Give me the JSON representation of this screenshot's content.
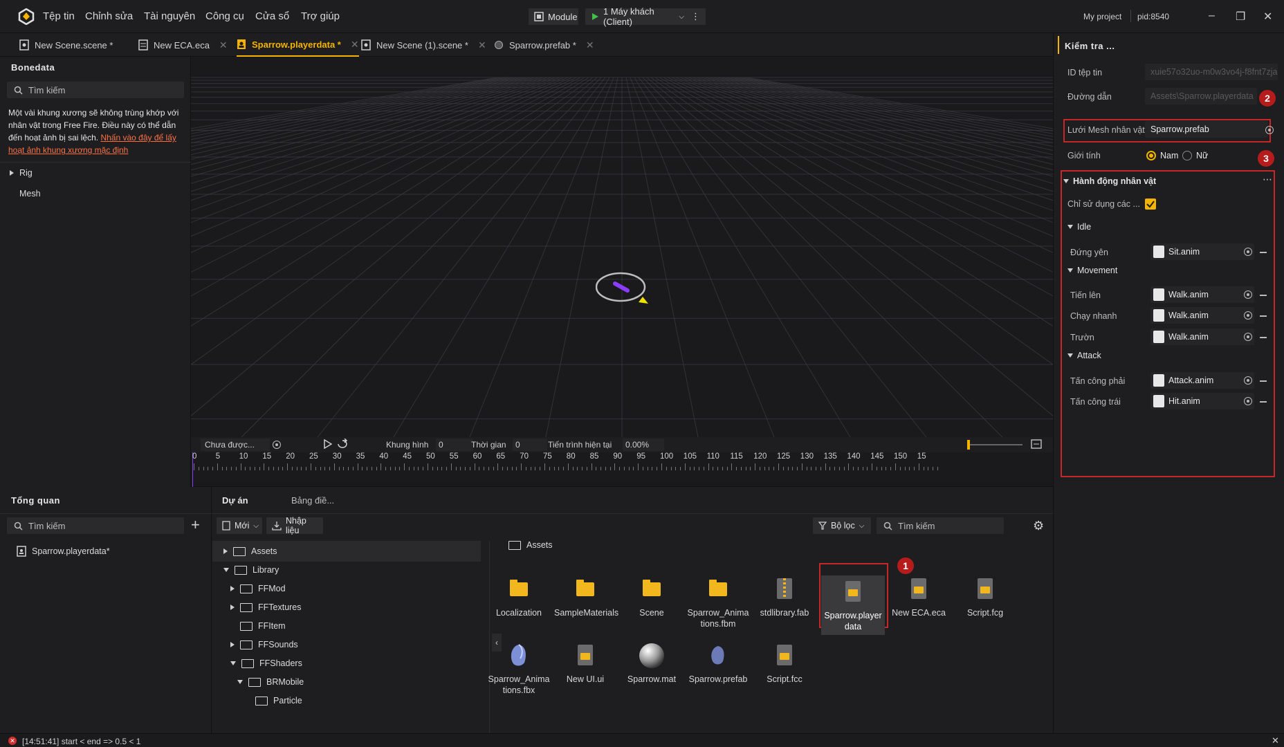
{
  "menu": [
    "Tệp tin",
    "Chỉnh sửa",
    "Tài nguyên",
    "Công cụ",
    "Cửa sổ",
    "Trợ giúp"
  ],
  "toolbar": {
    "module_label": "Module",
    "client_label": "1 Máy khách (Client)"
  },
  "project": {
    "name": "My project",
    "pid": "pid:8540"
  },
  "tabs": [
    {
      "label": "New Scene.scene *"
    },
    {
      "label": "New ECA.eca"
    },
    {
      "label": "Sparrow.playerdata *"
    },
    {
      "label": "New Scene (1).scene *"
    },
    {
      "label": "Sparrow.prefab *"
    }
  ],
  "bonedata": {
    "title": "Bonedata",
    "search_placeholder": "Tìm kiếm",
    "warning": "Một vài khung xương sẽ không trùng khớp với nhân vật trong Free Fire. Điều này có thể dẫn đến hoạt ảnh bị sai lệch.",
    "warning_link": "Nhấn vào đây để lấy hoạt ảnh khung xương mặc định",
    "tree": [
      "Rig",
      "Mesh"
    ]
  },
  "timeline": {
    "clip": "Chưa được...",
    "frame_label": "Khung hình",
    "frame_value": "0",
    "time_label": "Thời gian",
    "time_value": "0",
    "progress_label": "Tiến trình hiện tại",
    "progress_value": "0.00%",
    "ticks": [
      "0",
      "5",
      "10",
      "15",
      "20",
      "25",
      "30",
      "35",
      "40",
      "45",
      "50",
      "55",
      "60",
      "65",
      "70",
      "75",
      "80",
      "85",
      "90",
      "95",
      "100",
      "105",
      "110",
      "115",
      "120",
      "125",
      "130",
      "135",
      "140",
      "145",
      "150",
      "15"
    ]
  },
  "inspector": {
    "title": "Kiểm tra ...",
    "file_id_label": "ID tệp tin",
    "file_id_value": "xuie57o32uo-m0w3vo4j-f8fnt7zja",
    "path_label": "Đường dẫn",
    "path_value": "Assets\\Sparrow.playerdata",
    "mesh_label": "Lưới Mesh nhân vật",
    "mesh_value": "Sparrow.prefab",
    "gender_label": "Giới tính",
    "gender_male": "Nam",
    "gender_female": "Nữ",
    "actions_title": "Hành động nhân vật",
    "only_use_label": "Chỉ sử dụng các ...",
    "groups": [
      {
        "name": "Idle",
        "items": [
          {
            "label": "Đứng yên",
            "value": "Sit.anim"
          }
        ]
      },
      {
        "name": "Movement",
        "items": [
          {
            "label": "Tiến lên",
            "value": "Walk.anim"
          },
          {
            "label": "Chạy nhanh",
            "value": "Walk.anim"
          },
          {
            "label": "Trườn",
            "value": "Walk.anim"
          }
        ]
      },
      {
        "name": "Attack",
        "items": [
          {
            "label": "Tấn công phải",
            "value": "Attack.anim"
          },
          {
            "label": "Tấn công trái",
            "value": "Hit.anim"
          }
        ]
      }
    ],
    "badges": [
      "2",
      "3"
    ]
  },
  "overview": {
    "title": "Tổng quan",
    "search_placeholder": "Tìm kiếm",
    "item": "Sparrow.playerdata*"
  },
  "project_panel": {
    "tab_project": "Dự án",
    "tab_board": "Bảng điề...",
    "new_label": "Mới",
    "import_label": "Nhập liệu",
    "filter_label": "Bộ lọc",
    "search_placeholder": "Tìm kiếm",
    "breadcrumb": "Assets",
    "tree": [
      {
        "label": "Assets"
      },
      {
        "label": "Library"
      },
      {
        "label": "FFMod"
      },
      {
        "label": "FFTextures"
      },
      {
        "label": "FFItem"
      },
      {
        "label": "FFSounds"
      },
      {
        "label": "FFShaders"
      },
      {
        "label": "BRMobile"
      },
      {
        "label": "Particle"
      }
    ],
    "assets_row1": [
      "Localization",
      "SampleMaterials",
      "Scene",
      "Sparrow_Animations.fbm",
      "stdlibrary.fab",
      "Sparrow.playerdata",
      "New ECA.eca",
      "Script.fcg"
    ],
    "assets_row2": [
      "Sparrow_Animations.fbx",
      "New UI.ui",
      "Sparrow.mat",
      "Sparrow.prefab",
      "Script.fcc"
    ],
    "badge": "1"
  },
  "status": {
    "message": "[14:51:41] start < end => 0.5 < 1"
  },
  "colors": {
    "accent": "#f4b400",
    "highlight": "#c62828",
    "link": "#ff7043"
  }
}
